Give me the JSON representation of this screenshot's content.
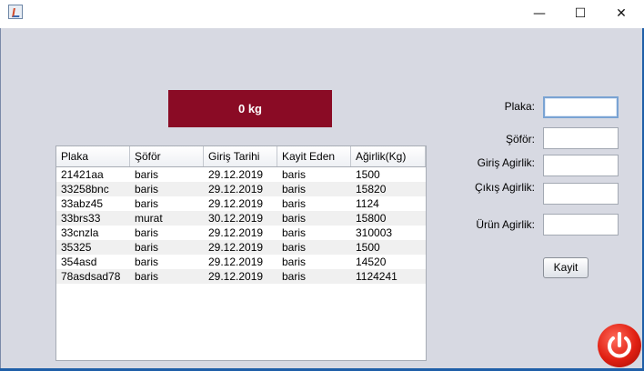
{
  "window": {
    "minimize_glyph": "—",
    "maximize_glyph": "☐",
    "close_glyph": "✕"
  },
  "weight_display": {
    "text": "0 kg",
    "bg_color": "#8a0b25"
  },
  "table": {
    "columns": [
      "Plaka",
      "Şöför",
      "Giriş Tarihi",
      "Kayit Eden",
      "Ağirlik(Kg)"
    ],
    "rows": [
      [
        "21421aa",
        "baris",
        "29.12.2019",
        "baris",
        "1500"
      ],
      [
        "33258bnc",
        "baris",
        "29.12.2019",
        "baris",
        "15820"
      ],
      [
        "33abz45",
        "baris",
        "29.12.2019",
        "baris",
        "1124"
      ],
      [
        "33brs33",
        "murat",
        "30.12.2019",
        "baris",
        "15800"
      ],
      [
        "33cnzla",
        "baris",
        "29.12.2019",
        "baris",
        "310003"
      ],
      [
        "35325",
        "baris",
        "29.12.2019",
        "baris",
        "1500"
      ],
      [
        "354asd",
        "baris",
        "29.12.2019",
        "baris",
        "14520"
      ],
      [
        "78asdsad78",
        "baris",
        "29.12.2019",
        "baris",
        "1124241"
      ]
    ]
  },
  "form": {
    "plaka_label": "Plaka:",
    "sofor_label": "Şöför:",
    "giris_label": "Giriş Agirlik:",
    "cikis_label": "Çıkış Agirlik:",
    "urun_label": "Ürün Agirlik:",
    "plaka_value": "",
    "sofor_value": "",
    "giris_value": "",
    "cikis_value": "",
    "urun_value": "",
    "submit_label": "Kayit"
  },
  "icons": {
    "app": "java-app-icon",
    "power": "power-icon"
  }
}
